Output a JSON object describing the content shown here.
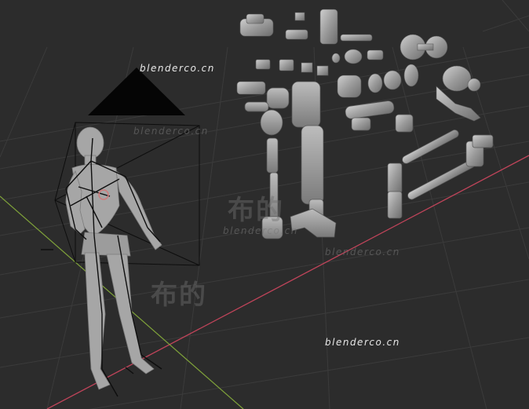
{
  "viewport": {
    "watermarks": {
      "site_top": "blenderco.cn",
      "site_top_faint": "blenderco.cn",
      "site_mid_faint": "blenderco.cn",
      "site_right_faint": "blenderco.cn",
      "site_bottom": "blenderco.cn",
      "cn_mid": "布的",
      "cn_lower": "布的"
    },
    "colors": {
      "background": "#2c2c2c",
      "grid": "#3a3a3a",
      "x_axis": "#c0445a",
      "y_axis": "#7fa23a",
      "mesh": "#9a9a9a",
      "bone": "#111111"
    },
    "objects": [
      "camera-object",
      "armature-character",
      "robot-parts-kit"
    ]
  }
}
